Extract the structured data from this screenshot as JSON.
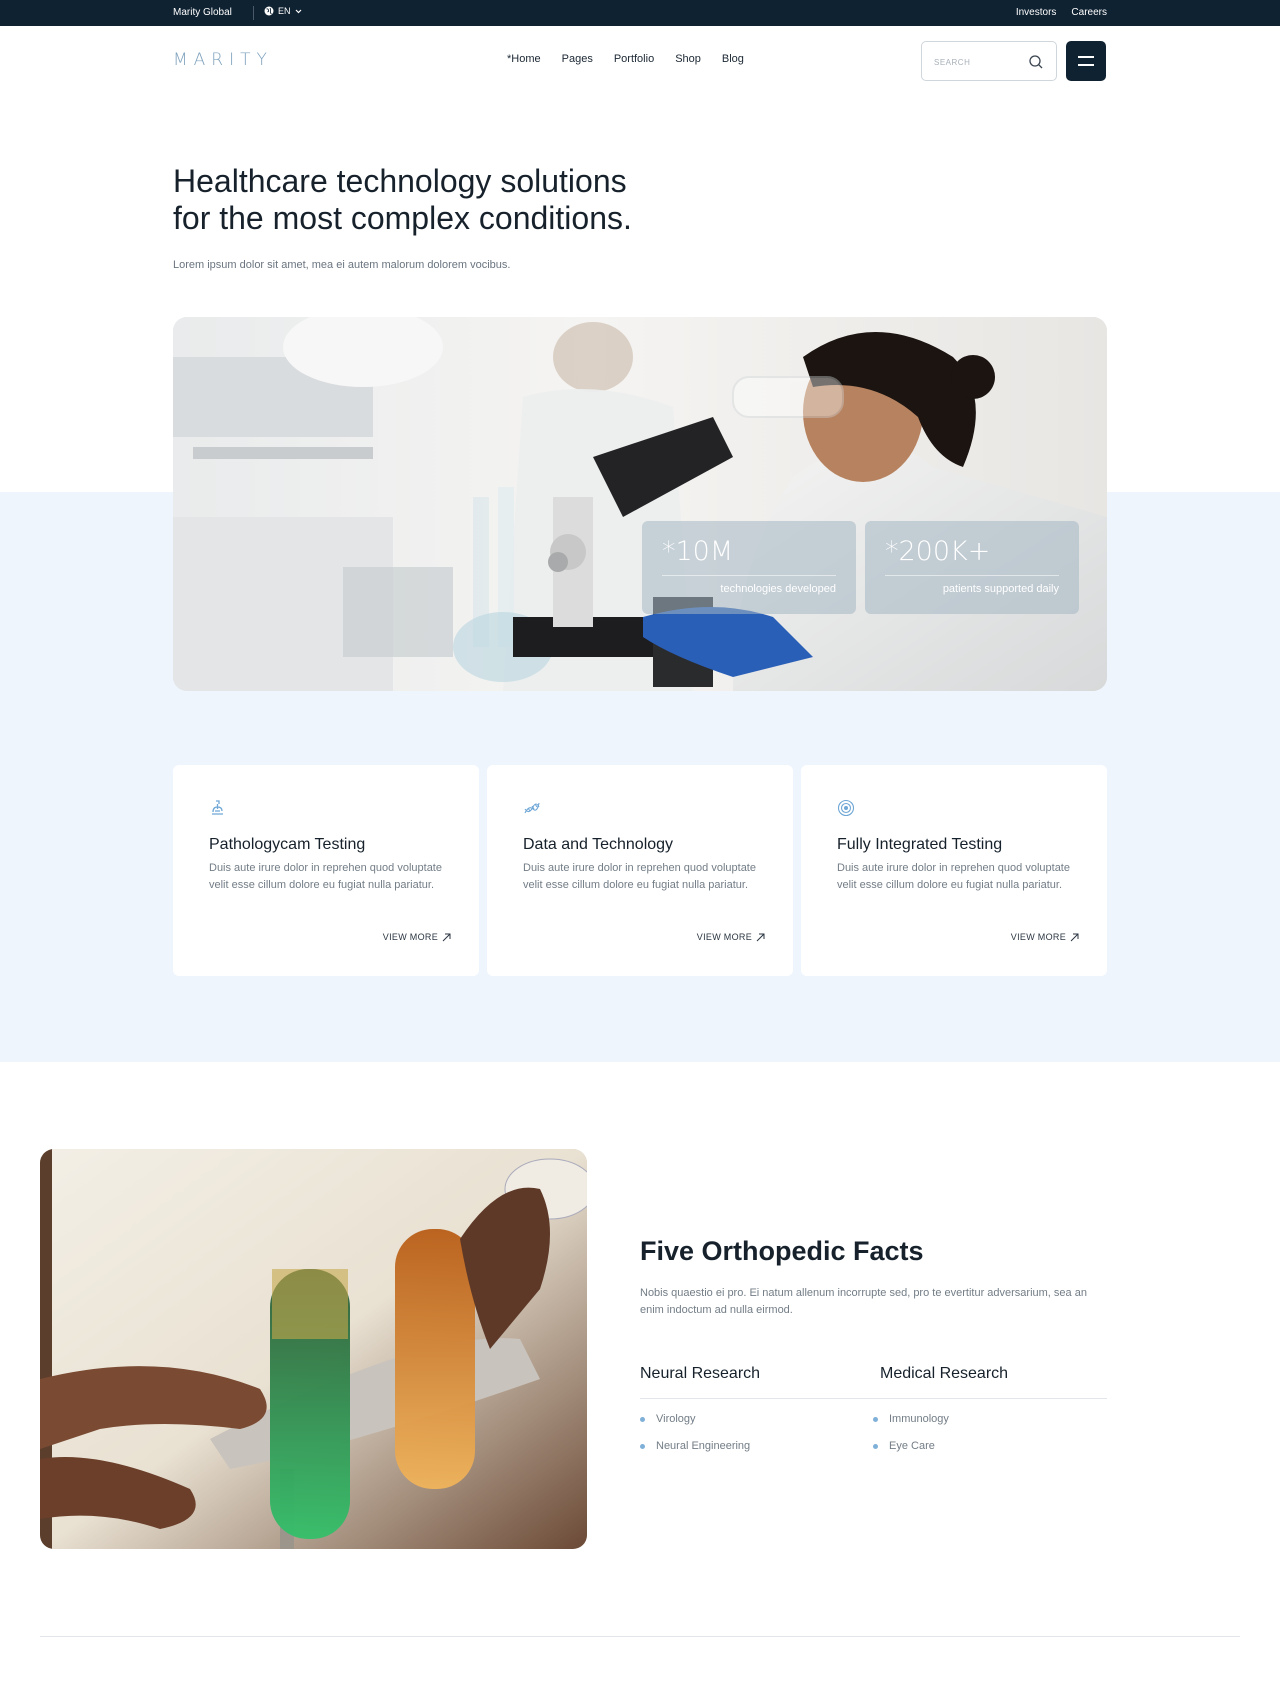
{
  "topbar": {
    "brand": "Marity Global",
    "language": "EN",
    "links": [
      "Investors",
      "Careers"
    ]
  },
  "header": {
    "logo": "MARITY",
    "nav": [
      "*Home",
      "Pages",
      "Portfolio",
      "Shop",
      "Blog"
    ],
    "search_placeholder": "SEARCH"
  },
  "hero": {
    "title_line1": "Healthcare technology solutions",
    "title_line2": "for the most complex conditions.",
    "subtitle": "Lorem ipsum dolor sit amet, mea ei autem malorum dolorem vocibus.",
    "stats": [
      {
        "value": "*10M",
        "label": "technologies developed"
      },
      {
        "value": "*200K+",
        "label": "patients supported daily"
      }
    ]
  },
  "cards": [
    {
      "icon": "microscope-icon",
      "title": "Pathologycam Testing",
      "desc": "Duis aute irure dolor in reprehen quod voluptate velit esse cillum dolore eu fugiat nulla pariatur.",
      "more": "VIEW MORE"
    },
    {
      "icon": "dna-icon",
      "title": "Data and Technology",
      "desc": "Duis aute irure dolor in reprehen quod voluptate velit esse cillum dolore eu fugiat nulla pariatur.",
      "more": "VIEW MORE"
    },
    {
      "icon": "target-icon",
      "title": "Fully Integrated Testing",
      "desc": "Duis aute irure dolor in reprehen quod voluptate velit esse cillum dolore eu fugiat nulla pariatur.",
      "more": "VIEW MORE"
    }
  ],
  "facts": {
    "title": "Five Orthopedic Facts",
    "desc": "Nobis quaestio ei pro. Ei natum allenum incorrupte sed, pro te evertitur adversarium, sea an enim indoctum ad nulla eirmod.",
    "columns": [
      {
        "heading": "Neural Research",
        "items": [
          "Virology",
          "Neural Engineering"
        ]
      },
      {
        "heading": "Medical Research",
        "items": [
          "Immunology",
          "Eye Care"
        ]
      }
    ]
  },
  "colors": {
    "dark": "#0f2232",
    "light_blue_bg": "#eef5fd",
    "accent": "#7fb0d8"
  }
}
